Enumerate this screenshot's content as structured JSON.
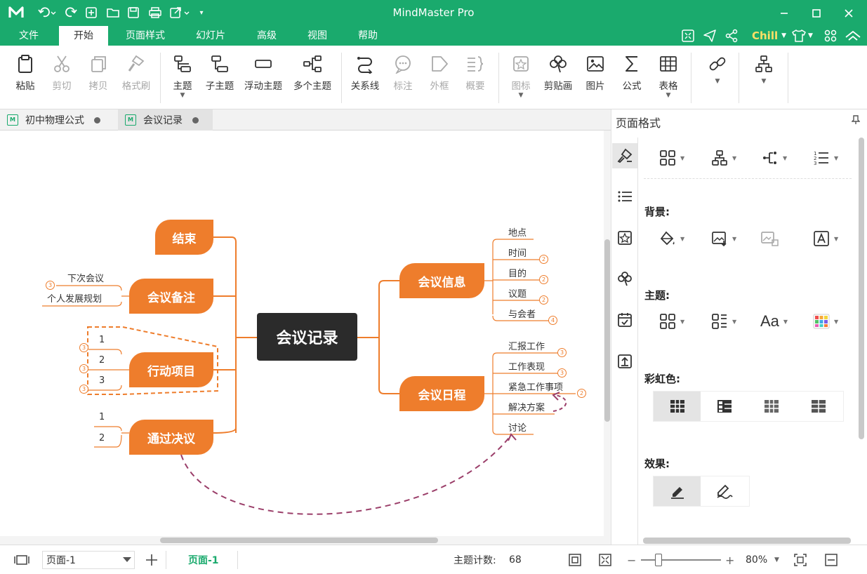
{
  "app": {
    "title": "MindMaster Pro",
    "chill": "Chill"
  },
  "menu": {
    "tabs": [
      "文件",
      "开始",
      "页面样式",
      "幻灯片",
      "高级",
      "视图",
      "帮助"
    ],
    "active": "开始"
  },
  "ribbon": {
    "paste": "粘贴",
    "cut": "剪切",
    "copy": "拷贝",
    "format_brush": "格式刷",
    "topic": "主题",
    "subtopic": "子主题",
    "floating": "浮动主题",
    "multiple": "多个主题",
    "relation": "关系线",
    "callout": "标注",
    "boundary": "外框",
    "summary": "概要",
    "icon": "图标",
    "clipart": "剪贴画",
    "picture": "图片",
    "formula": "公式",
    "table": "表格"
  },
  "doc_tabs": [
    "初中物理公式",
    "会议记录"
  ],
  "mindmap": {
    "central": "会议记录",
    "left_topics": [
      "结束",
      "会议备注",
      "行动项目",
      "通过决议"
    ],
    "right_topics": [
      "会议信息",
      "会议日程"
    ],
    "notes_items": [
      "下次会议",
      "个人发展规划"
    ],
    "action_items": [
      "1",
      "2",
      "3"
    ],
    "resolution_items": [
      "1",
      "2"
    ],
    "info_items": [
      "地点",
      "时间",
      "目的",
      "议题",
      "与会者"
    ],
    "agenda_items": [
      "汇报工作",
      "工作表现",
      "紧急工作事项",
      "解决方案",
      "讨论"
    ],
    "badges": {
      "notes": [
        "3"
      ],
      "actions": [
        "3",
        "3",
        "3"
      ],
      "info": [
        "2",
        "2",
        "2",
        "4"
      ],
      "agenda": [
        "3",
        "3",
        "2"
      ]
    }
  },
  "panel": {
    "title": "页面格式",
    "background": "背景:",
    "theme": "主题:",
    "rainbow": "彩虹色:",
    "effect": "效果:",
    "font_label": "Aa"
  },
  "status": {
    "page_select": "页面-1",
    "page_tab": "页面-1",
    "topic_count_label": "主题计数:",
    "topic_count": "68",
    "zoom": "80%"
  },
  "colors": {
    "brand": "#1aaa6d",
    "topic": "#ee7d2c",
    "central": "#2b2b2b",
    "relation": "#9b3f6a"
  }
}
